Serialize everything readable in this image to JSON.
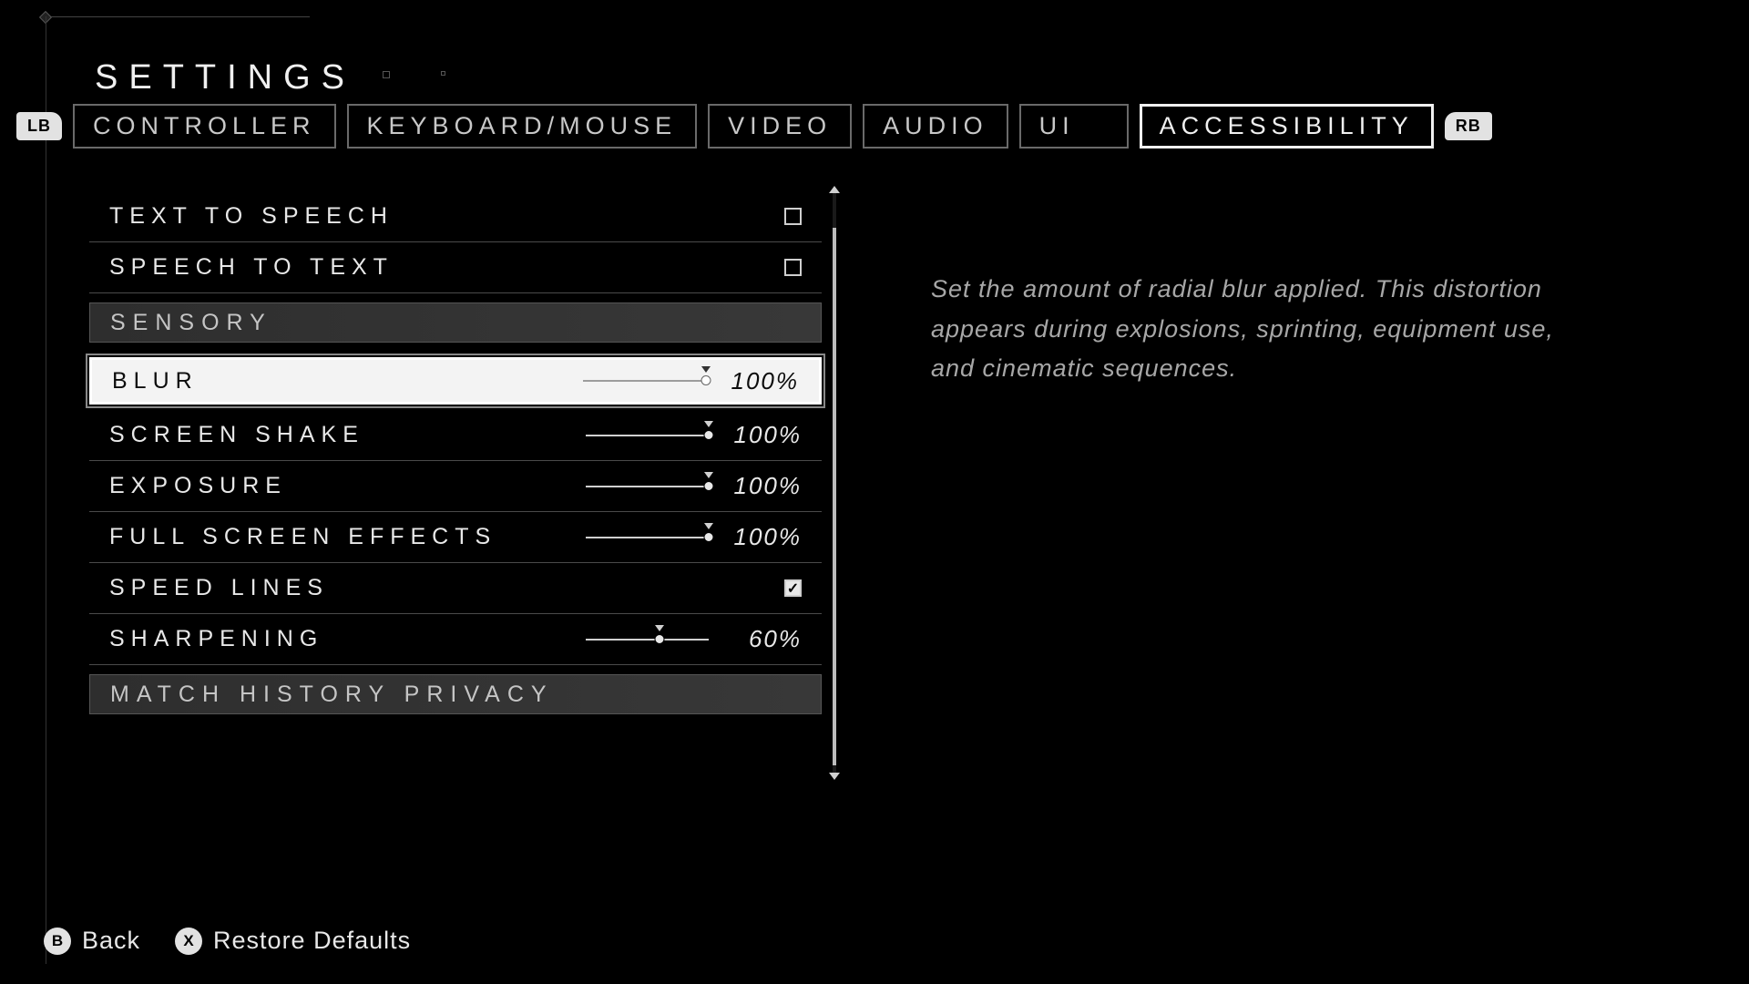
{
  "title": "SETTINGS",
  "bumpers": {
    "left": "LB",
    "right": "RB"
  },
  "tabs": [
    {
      "id": "controller",
      "label": "CONTROLLER",
      "active": false
    },
    {
      "id": "kbm",
      "label": "KEYBOARD/MOUSE",
      "active": false
    },
    {
      "id": "video",
      "label": "VIDEO",
      "active": false
    },
    {
      "id": "audio",
      "label": "AUDIO",
      "active": false
    },
    {
      "id": "ui",
      "label": "UI",
      "active": false
    },
    {
      "id": "accessibility",
      "label": "ACCESSIBILITY",
      "active": true
    }
  ],
  "settings": [
    {
      "type": "checkbox",
      "id": "tts",
      "label": "TEXT TO SPEECH",
      "checked": false
    },
    {
      "type": "checkbox",
      "id": "stt",
      "label": "SPEECH TO TEXT",
      "checked": false
    },
    {
      "type": "section",
      "id": "sensory",
      "label": "SENSORY"
    },
    {
      "type": "slider",
      "id": "blur",
      "label": "BLUR",
      "value": 100,
      "display": "100%",
      "selected": true
    },
    {
      "type": "slider",
      "id": "screenshake",
      "label": "SCREEN SHAKE",
      "value": 100,
      "display": "100%"
    },
    {
      "type": "slider",
      "id": "exposure",
      "label": "EXPOSURE",
      "value": 100,
      "display": "100%"
    },
    {
      "type": "slider",
      "id": "fse",
      "label": "FULL SCREEN EFFECTS",
      "value": 100,
      "display": "100%"
    },
    {
      "type": "checkbox",
      "id": "speedlines",
      "label": "SPEED LINES",
      "checked": true
    },
    {
      "type": "slider",
      "id": "sharpen",
      "label": "SHARPENING",
      "value": 60,
      "display": "60%"
    },
    {
      "type": "section",
      "id": "privacy",
      "label": "MATCH HISTORY PRIVACY"
    }
  ],
  "description": "Set the amount of radial blur applied. This distortion appears during explosions, sprinting, equipment use, and cinematic sequences.",
  "footer": {
    "back": {
      "key": "B",
      "label": "Back"
    },
    "restore": {
      "key": "X",
      "label": "Restore Defaults"
    }
  }
}
